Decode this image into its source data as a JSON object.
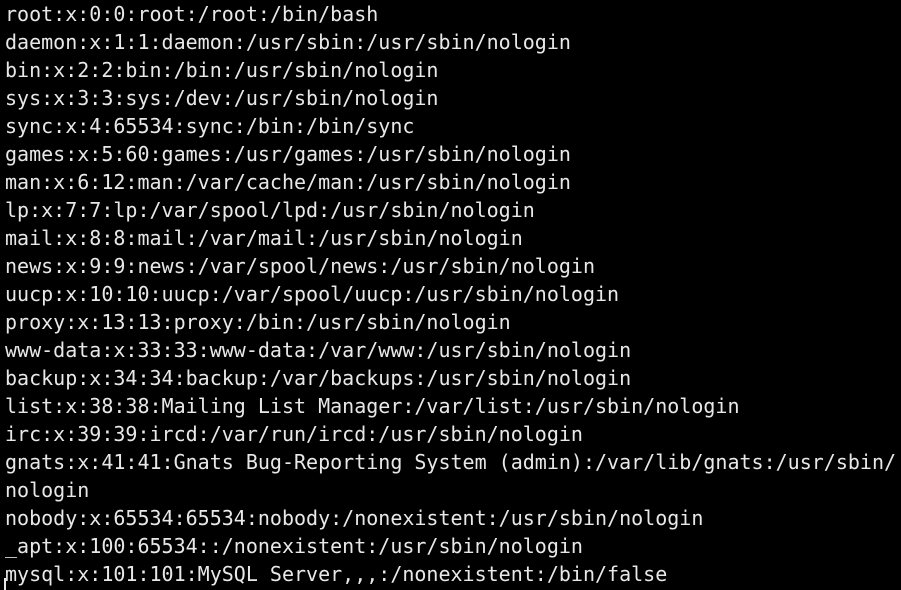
{
  "terminal": {
    "lines": [
      "root:x:0:0:root:/root:/bin/bash",
      "daemon:x:1:1:daemon:/usr/sbin:/usr/sbin/nologin",
      "bin:x:2:2:bin:/bin:/usr/sbin/nologin",
      "sys:x:3:3:sys:/dev:/usr/sbin/nologin",
      "sync:x:4:65534:sync:/bin:/bin/sync",
      "games:x:5:60:games:/usr/games:/usr/sbin/nologin",
      "man:x:6:12:man:/var/cache/man:/usr/sbin/nologin",
      "lp:x:7:7:lp:/var/spool/lpd:/usr/sbin/nologin",
      "mail:x:8:8:mail:/var/mail:/usr/sbin/nologin",
      "news:x:9:9:news:/var/spool/news:/usr/sbin/nologin",
      "uucp:x:10:10:uucp:/var/spool/uucp:/usr/sbin/nologin",
      "proxy:x:13:13:proxy:/bin:/usr/sbin/nologin",
      "www-data:x:33:33:www-data:/var/www:/usr/sbin/nologin",
      "backup:x:34:34:backup:/var/backups:/usr/sbin/nologin",
      "list:x:38:38:Mailing List Manager:/var/list:/usr/sbin/nologin",
      "irc:x:39:39:ircd:/var/run/ircd:/usr/sbin/nologin",
      "gnats:x:41:41:Gnats Bug-Reporting System (admin):/var/lib/gnats:/usr/sbin/",
      "nologin",
      "nobody:x:65534:65534:nobody:/nonexistent:/usr/sbin/nologin",
      "_apt:x:100:65534::/nonexistent:/usr/sbin/nologin",
      "mysql:x:101:101:MySQL Server,,,:/nonexistent:/bin/false"
    ]
  },
  "colors": {
    "background": "#000000",
    "foreground": "#e8e8e8"
  }
}
